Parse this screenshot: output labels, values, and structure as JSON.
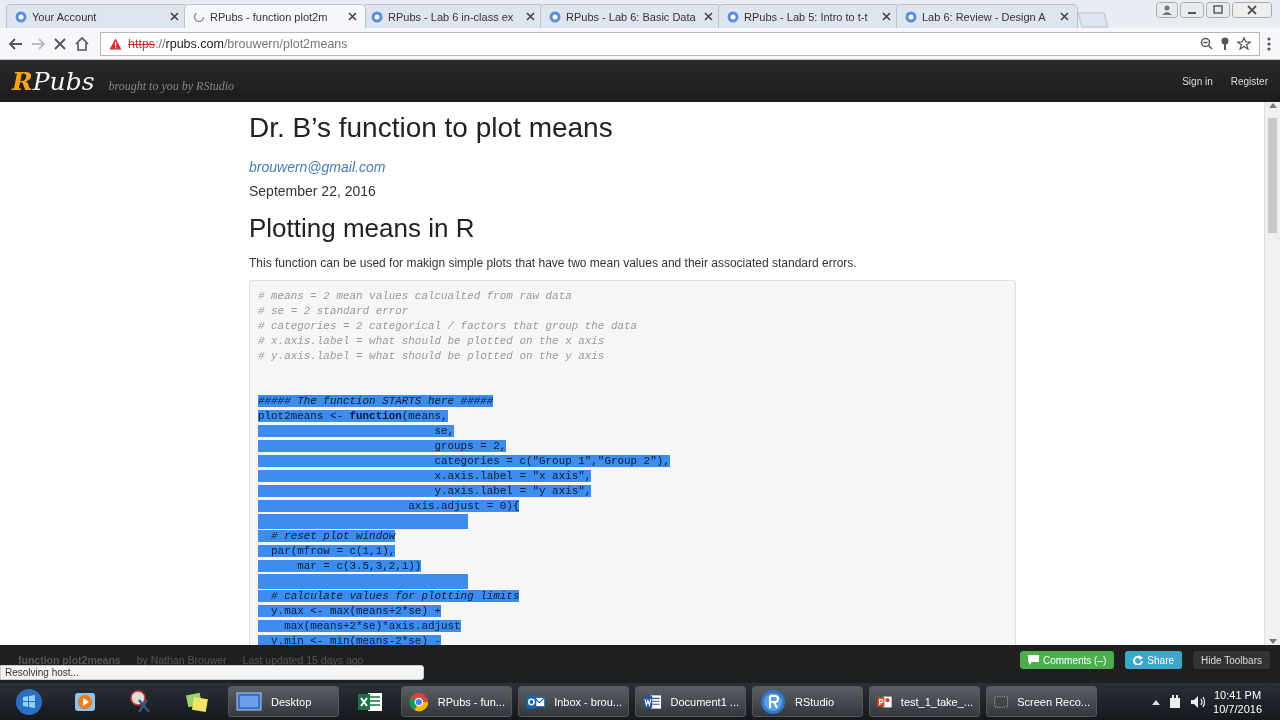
{
  "browser_tabs": [
    {
      "label": "Your Account",
      "selected": false,
      "loading": false
    },
    {
      "label": "RPubs - function plot2m",
      "selected": true,
      "loading": true
    },
    {
      "label": "RPubs - Lab 6 in-class ex",
      "selected": false,
      "loading": false
    },
    {
      "label": "RPubs - Lab 6: Basic Data",
      "selected": false,
      "loading": false
    },
    {
      "label": "RPubs - Lab 5: Intro to t-t",
      "selected": false,
      "loading": false
    },
    {
      "label": "Lab 6: Review - Design A",
      "selected": false,
      "loading": false
    }
  ],
  "address_bar": {
    "url": [
      {
        "text": "https",
        "kind": "insecure"
      },
      {
        "text": "://",
        "kind": "path"
      },
      {
        "text": "rpubs.com",
        "kind": "host"
      },
      {
        "text": "/brouwern/plot2means",
        "kind": "path"
      }
    ]
  },
  "site_header": {
    "logo_letter": "R",
    "logo_rest": "Pubs",
    "tagline": "brought to you by RStudio",
    "links": [
      "Sign in",
      "Register"
    ]
  },
  "document": {
    "title": "Dr. B’s function to plot means",
    "email": "brouwern@gmail.com",
    "date": "September 22, 2016",
    "heading": "Plotting means in R",
    "intro": "This function can be used for makign simple plots that have two mean values and their associated standard errors.",
    "code": [
      {
        "kind": "comment",
        "text": "# means = 2 mean values calcualted from raw data",
        "selected": false
      },
      {
        "kind": "comment",
        "text": "# se = 2 standard error",
        "selected": false
      },
      {
        "kind": "comment",
        "text": "# categories = 2 categorical / factors that group the data",
        "selected": false
      },
      {
        "kind": "comment",
        "text": "# x.axis.label = what should be plotted on the x axis",
        "selected": false
      },
      {
        "kind": "comment",
        "text": "# y.axis.label = what should be plotted on the y axis",
        "selected": false
      },
      {
        "kind": "blank",
        "selected": false
      },
      {
        "kind": "blank",
        "selected": false
      },
      {
        "kind": "comment",
        "text": "##### The function STARTS here #####",
        "selected": true
      },
      {
        "kind": "code",
        "text": "plot2means <- **function**(means,",
        "selected": true
      },
      {
        "kind": "code",
        "text": "                           se,",
        "selected": true
      },
      {
        "kind": "code",
        "text": "                           groups = 2,",
        "selected": true
      },
      {
        "kind": "code",
        "text": "                           categories = c(\"Group 1\",\"Group 2\"),",
        "selected": true
      },
      {
        "kind": "code",
        "text": "                           x.axis.label = \"x axis\",",
        "selected": true
      },
      {
        "kind": "code",
        "text": "                           y.axis.label = \"y axis\",",
        "selected": true
      },
      {
        "kind": "code",
        "text": "                       axis.adjust = 0){",
        "selected": true
      },
      {
        "kind": "blank",
        "selected": true
      },
      {
        "kind": "comment",
        "text": "  # reset plot window",
        "selected": true
      },
      {
        "kind": "code",
        "text": "  par(mfrow = c(1,1),",
        "selected": true
      },
      {
        "kind": "code",
        "text": "      mar = c(3.5,3,2,1))",
        "selected": true
      },
      {
        "kind": "blank",
        "selected": true
      },
      {
        "kind": "comment",
        "text": "  # calculate values for plotting limits",
        "selected": true
      },
      {
        "kind": "code",
        "text": "  y.max <- max(means+2*se) +",
        "selected": true
      },
      {
        "kind": "code",
        "text": "    max(means+2*se)*axis.adjust",
        "selected": true
      },
      {
        "kind": "code",
        "text": "  y.min <- min(means-2*se) -",
        "selected": true
      }
    ]
  },
  "doc_toolbar": {
    "name": "function plot2means",
    "author": "by Nathan Brouwer",
    "updated": "Last updated 15 days ago",
    "buttons": [
      {
        "label": "Comments (–)",
        "kind": "comments"
      },
      {
        "label": "Share",
        "kind": "share"
      },
      {
        "label": "Hide Toolbars",
        "kind": "plain"
      }
    ]
  },
  "status_bubble": "Resolving host...",
  "taskbar": {
    "items": [
      {
        "kind": "start"
      },
      {
        "kind": "media"
      },
      {
        "kind": "snip"
      },
      {
        "kind": "notes"
      },
      {
        "kind": "desktop",
        "label": "Desktop"
      },
      {
        "kind": "excel"
      },
      {
        "kind": "chrome",
        "label": "RPubs - fun..."
      },
      {
        "kind": "outlook",
        "label": "Inbox - brou..."
      },
      {
        "kind": "word",
        "label": "Document1 ..."
      },
      {
        "kind": "rstudio",
        "label": "RStudio"
      },
      {
        "kind": "powerpoint",
        "label": "test_1_take_..."
      },
      {
        "kind": "recorder",
        "label": "Screen Reco..."
      }
    ],
    "time": "10:41 PM",
    "date": "10/7/2016"
  }
}
